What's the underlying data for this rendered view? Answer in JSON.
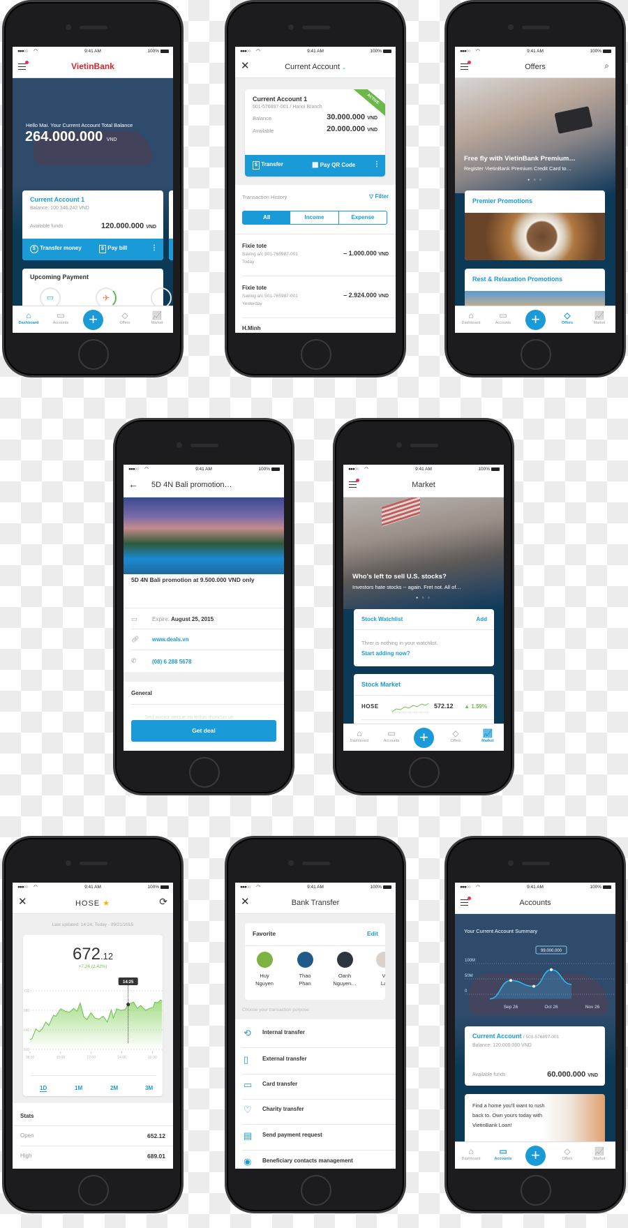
{
  "status_bar": {
    "signal": "●●●○○",
    "wifi_icon": "wifi-icon",
    "time": "9:41 AM",
    "battery": "100%"
  },
  "bottom_nav": {
    "items": [
      {
        "label": "Dashboard",
        "icon": "home-icon"
      },
      {
        "label": "Accounts",
        "icon": "cards-icon"
      },
      {
        "label": "Offers",
        "icon": "tag-icon"
      },
      {
        "label": "Market",
        "icon": "chart-icon"
      }
    ],
    "add_icon": "plus-icon"
  },
  "colors": {
    "primary": "#1a9ad6",
    "hero": "#2e4b6b",
    "navy": "#0c3a56",
    "positive": "#6cc04a",
    "brand_red": "#d7262f",
    "active_badge": "#6cb84a"
  },
  "dashboard": {
    "logo": "VietinBank",
    "greeting": "Hello Mai. Your Current Account Total Balance",
    "total_balance": "264.000.000",
    "currency": "VND",
    "account_card": {
      "title": "Current Account 1",
      "balance": "Balance: 100.346.242 VND",
      "available_label": "Available funds",
      "available_amount": "120.000.000",
      "currency": "VND",
      "transfer": "Transfer money",
      "pay_bill": "Pay bill"
    },
    "upcoming": {
      "title": "Upcoming Payment"
    },
    "active_tab": "Dashboard"
  },
  "current_account": {
    "title": "Current Account",
    "card": {
      "name": "Current Account 1",
      "number": "501-576897-001 / Hanoi Branch",
      "badge": "ACTIVE",
      "balance_label": "Balance",
      "balance": "30.000.000",
      "available_label": "Available",
      "available": "20.000.000",
      "currency": "VND",
      "transfer": "Transfer",
      "pay_qr": "Pay QR Code"
    },
    "history_label": "Transaction History",
    "filter": "Filter",
    "segments": [
      "All",
      "Income",
      "Expense"
    ],
    "selected_segment": "All",
    "transactions": [
      {
        "name": "Fixie tote",
        "account": "Saving a/c 501-765987-001",
        "date": "Today",
        "amount": "– 1.000.000",
        "currency": "VND"
      },
      {
        "name": "Fixie tote",
        "account": "Saving a/c 501-765987-001",
        "date": "Yesterday",
        "amount": "– 2.924.000",
        "currency": "VND"
      },
      {
        "name": "H.Minh"
      }
    ]
  },
  "offers": {
    "title": "Offers",
    "hero": {
      "title": "Free fly with VietinBank Premium…",
      "subtitle": "Register VietinBank Premium Credit Card to…",
      "pages": 3,
      "current_page": 1
    },
    "sections": [
      "Premier Promotions",
      "Rest & Relaxation Promotions"
    ],
    "active_tab": "Offers"
  },
  "bali": {
    "title": "5D 4N Bali promotion…",
    "headline": "5D 4N Bali promotion at 9.500.000 VND only",
    "expire_label": "Expire:",
    "expire_date": "August 25, 2015",
    "link": "www.deals.vn",
    "phone": "(08) 6 288 5678",
    "general": "General",
    "body_preview": "Sed auctor neque eu tellus rhoncus ut",
    "cta": "Get deal"
  },
  "market": {
    "title": "Market",
    "hero": {
      "title": "Who's left to sell U.S. stocks?",
      "subtitle": "Investors hate stocks -- again. Fret not. All of…",
      "pages": 3,
      "current_page": 1
    },
    "watchlist": {
      "title": "Stock Watchlist",
      "add": "Add",
      "empty": "Threr is nothing in your watchlist.",
      "cta": "Start adding now?"
    },
    "stock_market": {
      "title": "Stock Market",
      "rows": [
        {
          "symbol": "HOSE",
          "value": "572.12",
          "change": "▲ 1.59%"
        }
      ]
    },
    "active_tab": "Market"
  },
  "hose": {
    "title": "HOSE",
    "favorite": true,
    "last_updated": "Last updated: 14:24, Today - 09/21/2015",
    "price_int": "672",
    "price_dec": ".12",
    "change": "+7.24 (2.42%)",
    "ranges": [
      "1D",
      "1M",
      "2M",
      "3M"
    ],
    "selected_range": "1D",
    "stats_title": "Stats",
    "stats": [
      {
        "label": "Open",
        "value": "652.12"
      },
      {
        "label": "High",
        "value": "689.01"
      }
    ]
  },
  "chart_data": [
    {
      "type": "area",
      "xlabel": "",
      "ylabel": "",
      "x_ticks": [
        "08:00",
        "10:00",
        "12:00",
        "14:00",
        "16:00"
      ],
      "y_ticks": [
        600,
        640,
        680,
        720
      ],
      "ylim": [
        600,
        720
      ],
      "xlim": [
        "08:00",
        "16:40"
      ],
      "grid": true,
      "tooltip": {
        "x": "14:25",
        "label": "14:25",
        "y": 692
      },
      "x": [
        "08:00",
        "08:08",
        "08:23",
        "08:36",
        "08:49",
        "09:02",
        "09:14",
        "09:32",
        "09:42",
        "10:00",
        "10:19",
        "10:35",
        "10:51",
        "11:04",
        "11:17",
        "11:31",
        "11:43",
        "11:59",
        "12:15",
        "12:31",
        "12:47",
        "13:03",
        "13:19",
        "13:27",
        "13:40",
        "13:56",
        "14:12",
        "14:25",
        "14:46",
        "15:01",
        "15:14",
        "15:33",
        "15:49",
        "16:03",
        "16:10",
        "16:21",
        "16:31",
        "16:38"
      ],
      "y": [
        620,
        622,
        642,
        636,
        643,
        656,
        649,
        670,
        668,
        683,
        678,
        676,
        684,
        678,
        695,
        667,
        661,
        675,
        664,
        662,
        668,
        656,
        681,
        664,
        683,
        680,
        681,
        692,
        697,
        684,
        690,
        680,
        684,
        686,
        697,
        695,
        701,
        700
      ]
    },
    {
      "type": "area",
      "title": "Your Current Account Summary",
      "y_ticks": [
        "0",
        "50M",
        "100M"
      ],
      "ylim": [
        0,
        120
      ],
      "x_ticks": [
        "Sep 26",
        "Oct 26",
        "Nov 26"
      ],
      "grid": true,
      "x": [
        "Aug 12",
        "Sep 26",
        "Oct 12",
        "Oct 26",
        "Nov 10"
      ],
      "y": [
        -15,
        45,
        26,
        80,
        32
      ],
      "tooltip": {
        "x": "Oct 26",
        "label": "99.000.000"
      }
    }
  ],
  "bank_transfer": {
    "title": "Bank Transfer",
    "favorite_title": "Favorite",
    "edit": "Edit",
    "favorites": [
      {
        "first": "Huy",
        "last": "Nguyen",
        "color": "#7cb342"
      },
      {
        "first": "Thao",
        "last": "Phan",
        "color": "#1f5a8a"
      },
      {
        "first": "Oanh",
        "last": "Nguyen…",
        "color": "#2d3540"
      },
      {
        "first": "V",
        "last": "La",
        "color": "#d9d2cc"
      }
    ],
    "purpose_label": "Choose your transaction purpose",
    "options": [
      {
        "label": "Internal transfer",
        "icon": "refresh-dollar-icon"
      },
      {
        "label": "External transfer",
        "icon": "phone-dollar-icon"
      },
      {
        "label": "Card transfer",
        "icon": "card-icon"
      },
      {
        "label": "Charity transfer",
        "icon": "heart-icon"
      },
      {
        "label": "Send payment request",
        "icon": "invoice-icon"
      },
      {
        "label": "Beneficiary contacts management",
        "icon": "contact-icon"
      }
    ]
  },
  "accounts": {
    "title": "Accounts",
    "summary_title": "Your Current Account Summary",
    "card": {
      "name": "Current Account",
      "number": "/ 501-576897-001",
      "balance": "Balance: 120.000.000 VND",
      "available_label": "Available funds",
      "available": "60.000.000",
      "currency": "VND"
    },
    "promo": "Find a home you'll want to rush back to. Own yours today with VietinBank Loan!",
    "active_tab": "Accounts"
  }
}
